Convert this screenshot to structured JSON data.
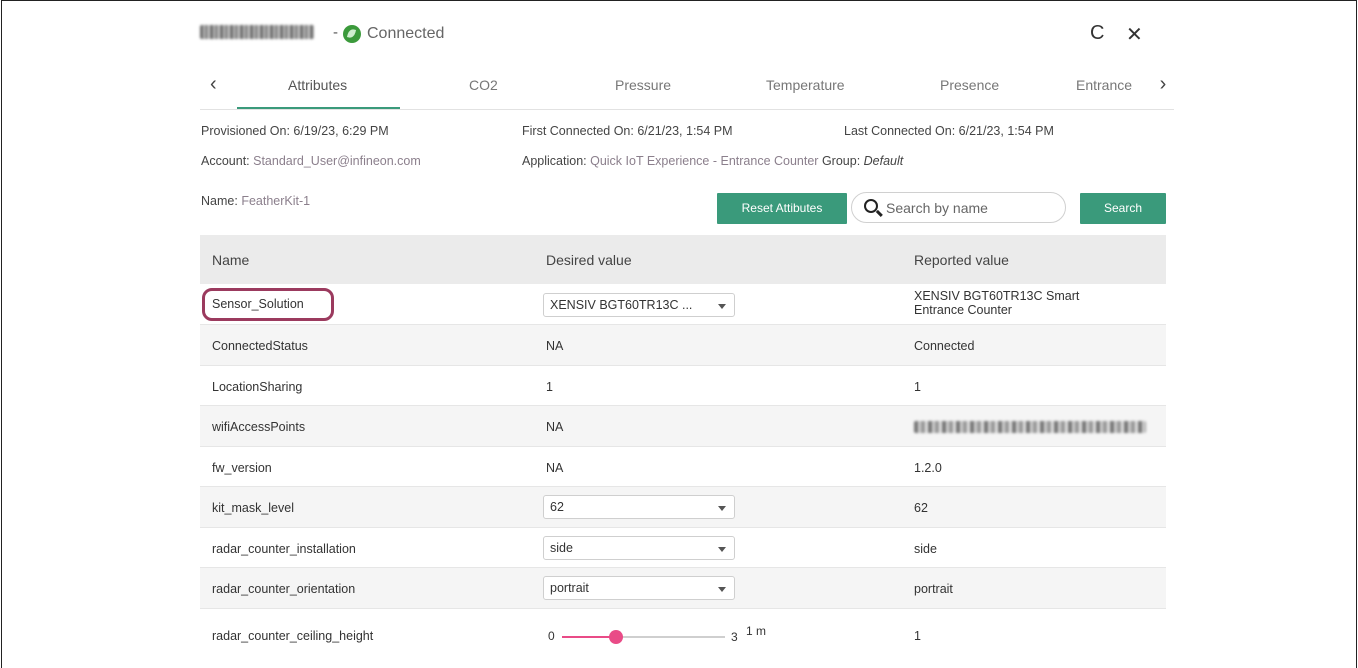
{
  "header": {
    "status_dash": "-",
    "status_label": "Connected",
    "refresh_glyph": "C",
    "close_glyph": "✕"
  },
  "tabs": {
    "prev_glyph": "‹",
    "next_glyph": "›",
    "items": [
      "Attributes",
      "CO2",
      "Pressure",
      "Temperature",
      "Presence",
      "Entrance"
    ]
  },
  "info": {
    "provisioned_label": "Provisioned On:",
    "provisioned_value": "6/19/23, 6:29 PM",
    "first_connected_label": "First Connected On:",
    "first_connected_value": "6/21/23, 1:54 PM",
    "last_connected_label": "Last Connected On:",
    "last_connected_value": "6/21/23, 1:54 PM",
    "account_label": "Account:",
    "account_value": "Standard_User@infineon.com",
    "application_label": "Application:",
    "application_value": "Quick IoT Experience - Entrance Counter",
    "group_label": "Group:",
    "group_value": "Default",
    "name_label": "Name:",
    "name_value": "FeatherKit-1"
  },
  "toolbar": {
    "reset_label": "Reset Attibutes",
    "search_placeholder": "Search by name",
    "search_button_label": "Search"
  },
  "table": {
    "headers": [
      "Name",
      "Desired value",
      "Reported value"
    ],
    "rows": [
      {
        "name": "Sensor_Solution",
        "desired": "XENSIV BGT60TR13C ...",
        "reported_line1": "XENSIV BGT60TR13C Smart",
        "reported_line2": "Entrance Counter"
      },
      {
        "name": "ConnectedStatus",
        "desired": "NA",
        "reported": "Connected"
      },
      {
        "name": "LocationSharing",
        "desired": "1",
        "reported": "1"
      },
      {
        "name": "wifiAccessPoints",
        "desired": "NA",
        "reported": ""
      },
      {
        "name": "fw_version",
        "desired": "NA",
        "reported": "1.2.0"
      },
      {
        "name": "kit_mask_level",
        "desired": "62",
        "reported": "62"
      },
      {
        "name": "radar_counter_installation",
        "desired": "side",
        "reported": "side"
      },
      {
        "name": "radar_counter_orientation",
        "desired": "portrait",
        "reported": "portrait"
      },
      {
        "name": "radar_counter_ceiling_height",
        "slider_min": "0",
        "slider_max": "3",
        "slider_value_label": "1 m",
        "slider_value": 1,
        "slider_range": [
          0,
          3
        ],
        "reported": "1"
      }
    ]
  },
  "colors": {
    "accent": "#3a9a7b",
    "slider": "#e94b87",
    "highlight": "#9b3a5e",
    "connected": "#3b9a3b"
  }
}
